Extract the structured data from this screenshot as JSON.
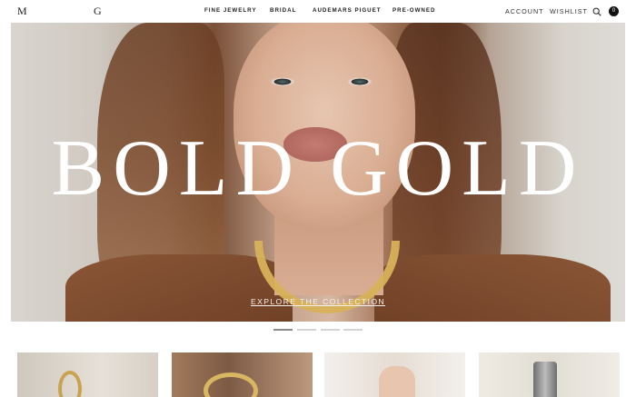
{
  "header": {
    "logo_left": "M",
    "logo_right": "G",
    "nav": [
      {
        "label": "FINE JEWELRY"
      },
      {
        "label": "BRIDAL"
      },
      {
        "label": "AUDEMARS PIGUET"
      },
      {
        "label": "PRE-OWNED"
      }
    ],
    "account_label": "ACCOUNT",
    "wishlist_label": "WISHLIST",
    "cart_count": "0",
    "icons": {
      "search": "search-icon",
      "cart": "bag-icon"
    }
  },
  "hero": {
    "title": "BOLD GOLD",
    "cta_label": "EXPLORE THE COLLECTION"
  },
  "carousel": {
    "slide_count": 4,
    "active_index": 0
  },
  "colors": {
    "hero_title": "#ffffff",
    "accent_gold": "#d9b25a",
    "pager_active": "#8a8a8a",
    "pager_inactive": "#d4d4d4"
  }
}
